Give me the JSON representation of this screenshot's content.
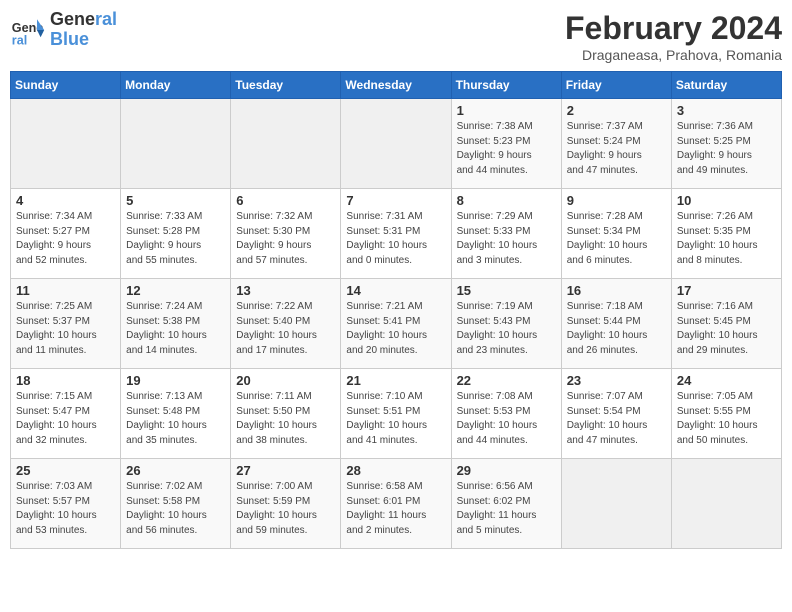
{
  "logo": {
    "text_general": "General",
    "text_blue": "Blue"
  },
  "header": {
    "month": "February 2024",
    "location": "Draganeasa, Prahova, Romania"
  },
  "weekdays": [
    "Sunday",
    "Monday",
    "Tuesday",
    "Wednesday",
    "Thursday",
    "Friday",
    "Saturday"
  ],
  "weeks": [
    [
      {
        "day": "",
        "info": ""
      },
      {
        "day": "",
        "info": ""
      },
      {
        "day": "",
        "info": ""
      },
      {
        "day": "",
        "info": ""
      },
      {
        "day": "1",
        "info": "Sunrise: 7:38 AM\nSunset: 5:23 PM\nDaylight: 9 hours\nand 44 minutes."
      },
      {
        "day": "2",
        "info": "Sunrise: 7:37 AM\nSunset: 5:24 PM\nDaylight: 9 hours\nand 47 minutes."
      },
      {
        "day": "3",
        "info": "Sunrise: 7:36 AM\nSunset: 5:25 PM\nDaylight: 9 hours\nand 49 minutes."
      }
    ],
    [
      {
        "day": "4",
        "info": "Sunrise: 7:34 AM\nSunset: 5:27 PM\nDaylight: 9 hours\nand 52 minutes."
      },
      {
        "day": "5",
        "info": "Sunrise: 7:33 AM\nSunset: 5:28 PM\nDaylight: 9 hours\nand 55 minutes."
      },
      {
        "day": "6",
        "info": "Sunrise: 7:32 AM\nSunset: 5:30 PM\nDaylight: 9 hours\nand 57 minutes."
      },
      {
        "day": "7",
        "info": "Sunrise: 7:31 AM\nSunset: 5:31 PM\nDaylight: 10 hours\nand 0 minutes."
      },
      {
        "day": "8",
        "info": "Sunrise: 7:29 AM\nSunset: 5:33 PM\nDaylight: 10 hours\nand 3 minutes."
      },
      {
        "day": "9",
        "info": "Sunrise: 7:28 AM\nSunset: 5:34 PM\nDaylight: 10 hours\nand 6 minutes."
      },
      {
        "day": "10",
        "info": "Sunrise: 7:26 AM\nSunset: 5:35 PM\nDaylight: 10 hours\nand 8 minutes."
      }
    ],
    [
      {
        "day": "11",
        "info": "Sunrise: 7:25 AM\nSunset: 5:37 PM\nDaylight: 10 hours\nand 11 minutes."
      },
      {
        "day": "12",
        "info": "Sunrise: 7:24 AM\nSunset: 5:38 PM\nDaylight: 10 hours\nand 14 minutes."
      },
      {
        "day": "13",
        "info": "Sunrise: 7:22 AM\nSunset: 5:40 PM\nDaylight: 10 hours\nand 17 minutes."
      },
      {
        "day": "14",
        "info": "Sunrise: 7:21 AM\nSunset: 5:41 PM\nDaylight: 10 hours\nand 20 minutes."
      },
      {
        "day": "15",
        "info": "Sunrise: 7:19 AM\nSunset: 5:43 PM\nDaylight: 10 hours\nand 23 minutes."
      },
      {
        "day": "16",
        "info": "Sunrise: 7:18 AM\nSunset: 5:44 PM\nDaylight: 10 hours\nand 26 minutes."
      },
      {
        "day": "17",
        "info": "Sunrise: 7:16 AM\nSunset: 5:45 PM\nDaylight: 10 hours\nand 29 minutes."
      }
    ],
    [
      {
        "day": "18",
        "info": "Sunrise: 7:15 AM\nSunset: 5:47 PM\nDaylight: 10 hours\nand 32 minutes."
      },
      {
        "day": "19",
        "info": "Sunrise: 7:13 AM\nSunset: 5:48 PM\nDaylight: 10 hours\nand 35 minutes."
      },
      {
        "day": "20",
        "info": "Sunrise: 7:11 AM\nSunset: 5:50 PM\nDaylight: 10 hours\nand 38 minutes."
      },
      {
        "day": "21",
        "info": "Sunrise: 7:10 AM\nSunset: 5:51 PM\nDaylight: 10 hours\nand 41 minutes."
      },
      {
        "day": "22",
        "info": "Sunrise: 7:08 AM\nSunset: 5:53 PM\nDaylight: 10 hours\nand 44 minutes."
      },
      {
        "day": "23",
        "info": "Sunrise: 7:07 AM\nSunset: 5:54 PM\nDaylight: 10 hours\nand 47 minutes."
      },
      {
        "day": "24",
        "info": "Sunrise: 7:05 AM\nSunset: 5:55 PM\nDaylight: 10 hours\nand 50 minutes."
      }
    ],
    [
      {
        "day": "25",
        "info": "Sunrise: 7:03 AM\nSunset: 5:57 PM\nDaylight: 10 hours\nand 53 minutes."
      },
      {
        "day": "26",
        "info": "Sunrise: 7:02 AM\nSunset: 5:58 PM\nDaylight: 10 hours\nand 56 minutes."
      },
      {
        "day": "27",
        "info": "Sunrise: 7:00 AM\nSunset: 5:59 PM\nDaylight: 10 hours\nand 59 minutes."
      },
      {
        "day": "28",
        "info": "Sunrise: 6:58 AM\nSunset: 6:01 PM\nDaylight: 11 hours\nand 2 minutes."
      },
      {
        "day": "29",
        "info": "Sunrise: 6:56 AM\nSunset: 6:02 PM\nDaylight: 11 hours\nand 5 minutes."
      },
      {
        "day": "",
        "info": ""
      },
      {
        "day": "",
        "info": ""
      }
    ]
  ]
}
